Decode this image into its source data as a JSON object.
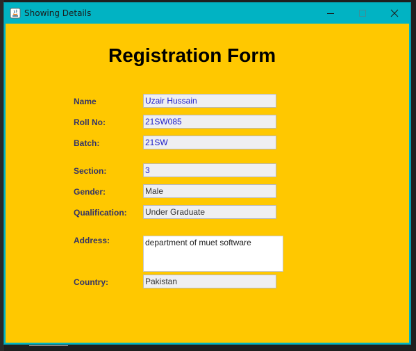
{
  "window": {
    "title": "Showing Details"
  },
  "form": {
    "heading": "Registration Form",
    "fields": [
      {
        "label": "Name",
        "value": "Uzair Hussain"
      },
      {
        "label": "Roll No:",
        "value": "21SW085"
      },
      {
        "label": "Batch:",
        "value": "21SW"
      },
      {
        "label": "Section:",
        "value": "3"
      },
      {
        "label": "Gender:",
        "value": "Male"
      },
      {
        "label": "Qualification:",
        "value": "Under Graduate"
      },
      {
        "label": "Address:",
        "value": "department of muet software"
      },
      {
        "label": "Country:",
        "value": "Pakistan"
      }
    ]
  },
  "colors": {
    "titlebar": "#01b3c3",
    "form_background": "#ffc800",
    "label_text": "#333366",
    "value_text_blue": "#1a1ac8"
  },
  "icons": {
    "app": "java-app-icon",
    "minimize": "minimize-icon",
    "maximize": "maximize-icon",
    "close": "close-icon"
  }
}
